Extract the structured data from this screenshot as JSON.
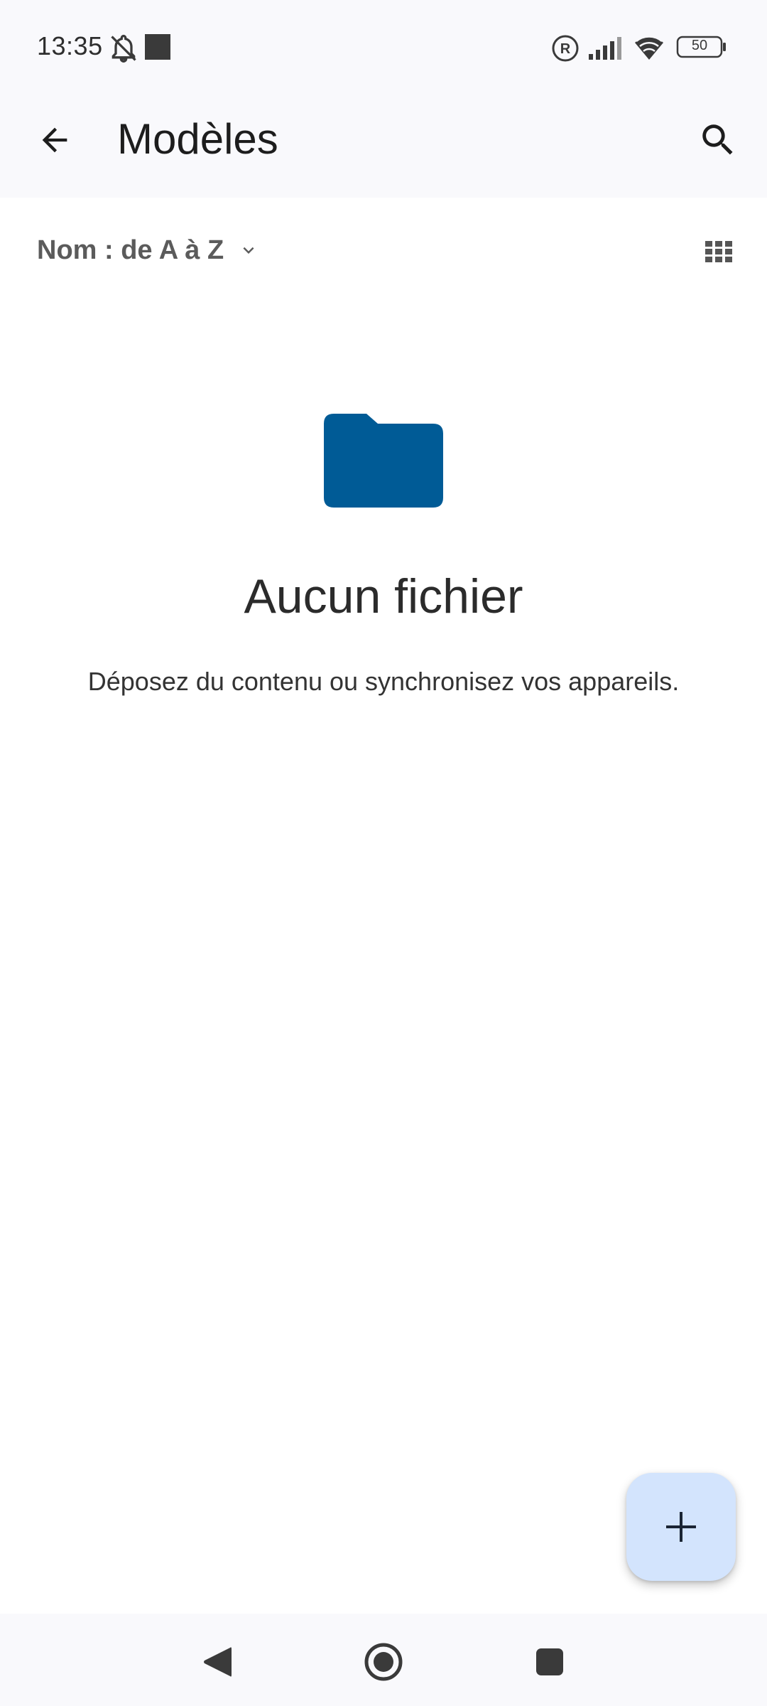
{
  "status_bar": {
    "time": "13:35",
    "battery_level": "50",
    "icons": [
      "notifications-off-icon",
      "media-square-icon",
      "registered-icon",
      "cellular-signal-icon",
      "wifi-icon",
      "battery-icon"
    ]
  },
  "app_bar": {
    "title": "Modèles",
    "back_icon": "arrow-left-icon",
    "search_icon": "search-icon"
  },
  "toolbar": {
    "sort_label": "Nom : de A à Z",
    "sort_icon": "chevron-down-icon",
    "view_icon": "grid-view-icon"
  },
  "empty_state": {
    "icon": "folder-icon",
    "title": "Aucun fichier",
    "subtitle": "Déposez du contenu ou synchronisez vos appareils."
  },
  "fab": {
    "icon": "plus-icon"
  },
  "nav_bar": {
    "icons": [
      "nav-back-icon",
      "nav-home-icon",
      "nav-recents-icon"
    ]
  },
  "colors": {
    "accent_folder": "#005b96",
    "fab_background": "#d3e4fd",
    "bar_background": "#f9f9fc"
  }
}
